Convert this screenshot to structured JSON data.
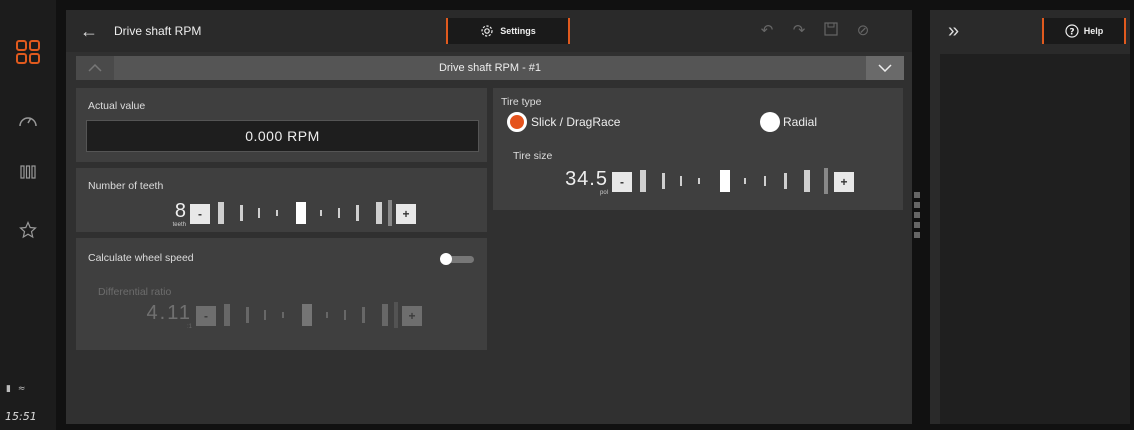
{
  "header": {
    "title": "Drive shaft RPM",
    "settings_label": "Settings"
  },
  "selector": {
    "value": "Drive shaft RPM - #1"
  },
  "actual_value": {
    "label": "Actual value",
    "value": "0.000 RPM"
  },
  "teeth": {
    "label": "Number of teeth",
    "value": "8",
    "unit": "teeth",
    "minus": "-",
    "plus": "+"
  },
  "wheel_speed": {
    "label": "Calculate wheel speed",
    "enabled": false,
    "diff_label": "Differential ratio",
    "diff_value": "4.11",
    "diff_unit": ":1",
    "minus": "-",
    "plus": "+"
  },
  "tire": {
    "type_label": "Tire type",
    "option_slick": "Slick / DragRace",
    "option_radial": "Radial",
    "selected": "Slick / DragRace",
    "size_label": "Tire size",
    "size_value": "34.5",
    "size_unit": "pol",
    "minus": "-",
    "plus": "+"
  },
  "right_panel": {
    "help_label": "Help"
  },
  "status": {
    "clock": "15:51"
  },
  "colors": {
    "accent": "#e05a1e",
    "radio_selected": "#e5531d"
  },
  "icons": [
    "apps-grid-icon",
    "gauge-icon",
    "columns-icon",
    "star-icon",
    "back-arrow-icon",
    "gear-icon",
    "undo-icon",
    "redo-icon",
    "save-icon",
    "cancel-icon",
    "chevron-up-icon",
    "chevron-down-icon",
    "double-chevron-right-icon",
    "help-icon",
    "battery-icon",
    "wifi-icon"
  ]
}
